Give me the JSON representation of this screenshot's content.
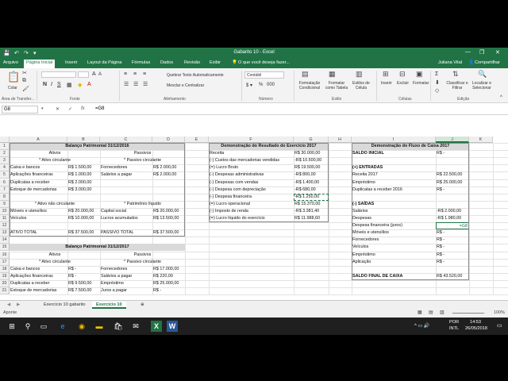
{
  "window": {
    "title": "Gabarito 10 - Excel",
    "controls": [
      "—",
      "❐",
      "✕"
    ]
  },
  "quick_access": [
    "💾",
    "↶",
    "↷",
    "▾"
  ],
  "ribbon_tabs": [
    "Arquivo",
    "Página Inicial",
    "Inserir",
    "Layout da Página",
    "Fórmulas",
    "Dados",
    "Revisão",
    "Exibir"
  ],
  "tell_me": "O que você deseja fazer...",
  "user": "Juliana Vital",
  "share": "Compartilhar",
  "ribbon": {
    "paste": "Colar",
    "clipboard_group": "Área de Transfer...",
    "font_group": "Fonte",
    "alignment_group": "Alinhamento",
    "wrap_text": "Quebrar Texto Automaticamente",
    "merge_center": "Mesclar e Centralizar",
    "number_group": "Número",
    "number_format": "Contábil",
    "conditional": "Formatação Condicional",
    "format_table": "Formatar como Tabela",
    "cell_styles": "Estilos de Célula",
    "styles_group": "Estilo",
    "insert": "Inserir",
    "delete": "Excluir",
    "format": "Formatar",
    "cells_group": "Células",
    "sort_filter": "Classificar e Filtrar",
    "find_select": "Localizar e Selecionar",
    "editing_group": "Edição"
  },
  "formula_bar": {
    "name_box": "G8",
    "fx": "fx",
    "formula": "=G8"
  },
  "columns": [
    "A",
    "B",
    "C",
    "D",
    "E",
    "F",
    "G",
    "H",
    "I",
    "J",
    "K"
  ],
  "rows": [
    "1",
    "2",
    "3",
    "4",
    "5",
    "6",
    "7",
    "8",
    "9",
    "10",
    "11",
    "12",
    "13",
    "14",
    "15",
    "16",
    "17",
    "18",
    "19",
    "20",
    "21"
  ],
  "balanco1": {
    "title": "Balanço Patrimonial 31/12/2016",
    "ativos": "Ativos",
    "passivos": "Passivos",
    "ativo_circ": "* Ativo circulante",
    "passivo_circ": "* Passivo circulante",
    "rows": [
      [
        "Caixa e bancos",
        "R$  1.500,00",
        "Fornecedores",
        "R$  2.000,00"
      ],
      [
        "Aplicações financeiras",
        "R$  1.000,00",
        "Salários a pagar",
        "R$  2.000,00"
      ],
      [
        "Duplicatas a receber",
        "R$  2.000,00",
        "",
        ""
      ],
      [
        "Estoque de mercadorias",
        "R$  3.000,00",
        "",
        ""
      ]
    ],
    "ativo_nc": "* Ativo não circulante",
    "patrimonio": "* Patrimônio líquido",
    "rows2": [
      [
        "Móveis e utensílios",
        "R$ 20.000,00",
        "Capital social",
        "R$ 20.000,00"
      ],
      [
        "Veículos",
        "R$ 10.000,00",
        "Lucros acumulados",
        "R$ 13.500,00"
      ]
    ],
    "total_ativo": "ATIVO TOTAL",
    "total_ativo_val": "R$ 37.500,00",
    "total_passivo": "PASSIVO TOTAL",
    "total_passivo_val": "R$ 37.500,00"
  },
  "balanco2": {
    "title": "Balanço Patrimonial 31/12/2017",
    "ativos": "Ativos",
    "passivos": "Passivos",
    "ativo_circ": "* Ativo circulante",
    "passivo_circ": "* Passivo circulante",
    "rows": [
      [
        "Caixa e bancos",
        "R$       -",
        "Fornecedores",
        "R$ 17.000,00"
      ],
      [
        "Aplicações financeiras",
        "R$       -",
        "Salários a pagar",
        "R$     220,00"
      ],
      [
        "Duplicatas a receber",
        "R$  9.500,00",
        "Empréstimo",
        "R$ 25.000,00"
      ],
      [
        "Estoque de mercadorias",
        "R$  7.500,00",
        "Juros a pagar",
        "R$       -"
      ]
    ]
  },
  "dre": {
    "title": "Demonstração do Resultado do Exercício 2017",
    "rows": [
      [
        "Receita",
        "R$ 30.000,00"
      ],
      [
        "(-) Custos das mercadorias vendidas",
        "-R$ 10.500,00"
      ],
      [
        "(=) Lucro Bruto",
        "R$ 19.500,00"
      ],
      [
        "(-) Despesas administrativas",
        "-R$     800,00"
      ],
      [
        "(-) Despesas com vendas",
        "-R$  1.400,00"
      ],
      [
        "(-) Despesa com depreciação",
        "-R$     680,00"
      ],
      [
        "(-) Despesa financeira",
        "-R$  1.250,00"
      ],
      [
        "(=) Lucro operacional",
        "R$ 15.370,00"
      ],
      [
        "(-) Imposto de renda",
        "-R$  3.381,40"
      ],
      [
        "(=) Lucro líquido do exercício",
        "R$ 11.988,60"
      ]
    ]
  },
  "dfc": {
    "title": "Demonstração do Fluxo de Caixa 2017",
    "saldo_inicial": "SALDO INICIAL",
    "saldo_inicial_val": "R$       -",
    "entradas": "(+) ENTRADAS",
    "entradas_rows": [
      [
        "Receita 2017",
        "R$ 22.500,00"
      ],
      [
        "Empréstimo",
        "R$ 25.000,00"
      ],
      [
        "Duplicatas a receber 2016",
        "R$       -"
      ]
    ],
    "saidas": "(-) SAÍDAS",
    "saidas_rows": [
      [
        "Salários",
        "-R$  2.000,00"
      ],
      [
        "Despesas",
        "-R$  1.980,00"
      ],
      [
        "Despesa financeira (juros)",
        "=G8"
      ],
      [
        "Móveis e utensílios",
        "R$       -"
      ],
      [
        "Fornecedores",
        "R$       -"
      ],
      [
        "Veículos",
        "R$       -"
      ],
      [
        "Empréstimo",
        "R$       -"
      ],
      [
        "Aplicação",
        "R$       -"
      ]
    ],
    "saldo_final": "SALDO FINAL DE CAIXA",
    "saldo_final_val": "R$ 43.520,00"
  },
  "sheets": [
    "Exercício 10 gabarito",
    "Exercício 10"
  ],
  "status": {
    "mode": "Aponte",
    "zoom": "100%"
  },
  "taskbar": {
    "lang1": "POR",
    "lang2": "INTL",
    "time": "14:53",
    "date": "26/05/2018"
  },
  "colors": {
    "excel_green": "#217346",
    "header_fill": "#d9d9d9"
  }
}
